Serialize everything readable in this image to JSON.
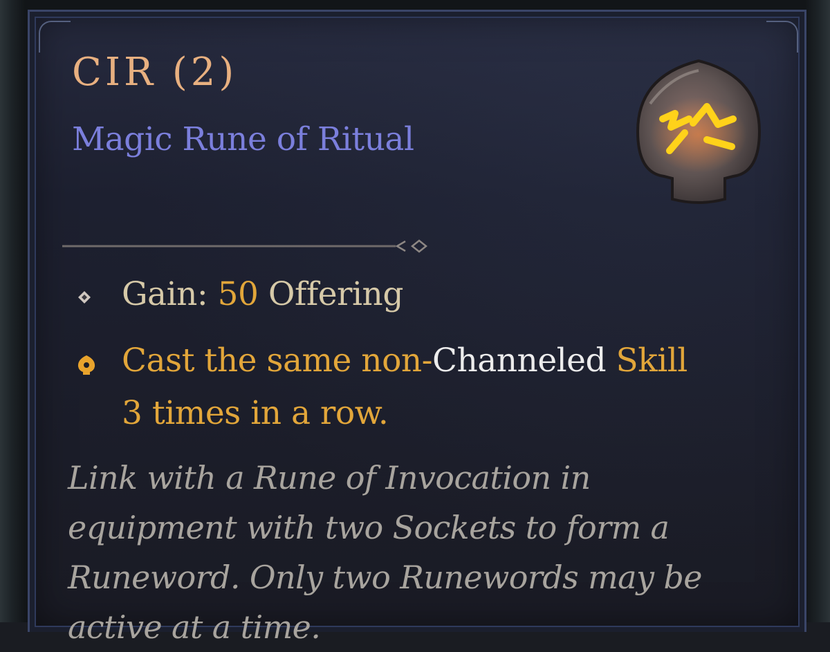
{
  "item": {
    "name": "CIR (2)",
    "subtitle": "Magic Rune of Ritual"
  },
  "icons": {
    "rune_image": "rune-icon",
    "bullet1": "diamond-bullet-icon",
    "bullet2": "gold-gem-bullet-icon",
    "divider": "ornamental-divider"
  },
  "stats": {
    "gain_label": "Gain: ",
    "gain_value": "50",
    "gain_unit": " Offering",
    "condition_part1": "Cast the same non-",
    "condition_highlight": "Channeled",
    "condition_part2": " Skill",
    "condition_line2": "3 times in a row."
  },
  "lore": "Link with a Rune of Invocation in equipment with two Sockets to form a Runeword. Only two Runewords may be active at a time.",
  "colors": {
    "title": "#e8b080",
    "rarity_magic": "#7b7fdc",
    "gold_text": "#e2a63a",
    "body_text": "#d6c9a8",
    "lore_text": "#a8a49e"
  }
}
